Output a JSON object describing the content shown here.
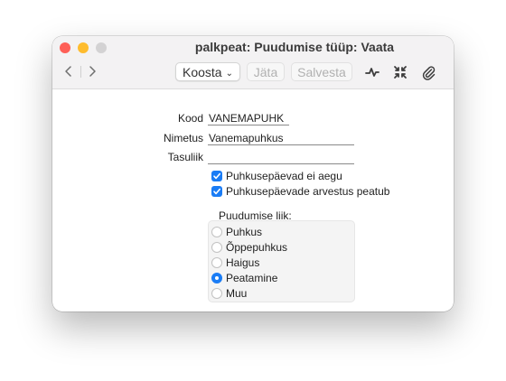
{
  "window": {
    "title": "palkpeat: Puudumise tüüp: Vaata"
  },
  "toolbar": {
    "back_label": "‹",
    "forward_label": "›",
    "koosta_label": "Koosta",
    "jata_label": "Jäta",
    "salvesta_label": "Salvesta",
    "icons": [
      "activity-icon",
      "shrink-icon",
      "paperclip-icon"
    ]
  },
  "form": {
    "kood_label": "Kood",
    "kood_value": "VANEMAPUHK",
    "nimetus_label": "Nimetus",
    "nimetus_value": "Vanemapuhkus",
    "tasuliik_label": "Tasuliik",
    "tasuliik_value": "",
    "checkbox1_label": "Puhkusepäevad ei aegu",
    "checkbox1_checked": true,
    "checkbox2_label": "Puhkusepäevade arvestus peatub",
    "checkbox2_checked": true,
    "group_title": "Puudumise liik:",
    "options": [
      {
        "label": "Puhkus",
        "selected": false
      },
      {
        "label": "Õppepuhkus",
        "selected": false
      },
      {
        "label": "Haigus",
        "selected": false
      },
      {
        "label": "Peatamine",
        "selected": true
      },
      {
        "label": "Muu",
        "selected": false
      }
    ]
  },
  "colors": {
    "accent": "#1a7cf5",
    "close": "#fe5f57",
    "minimize": "#febc2e",
    "maximize": "#d3d2d3"
  }
}
